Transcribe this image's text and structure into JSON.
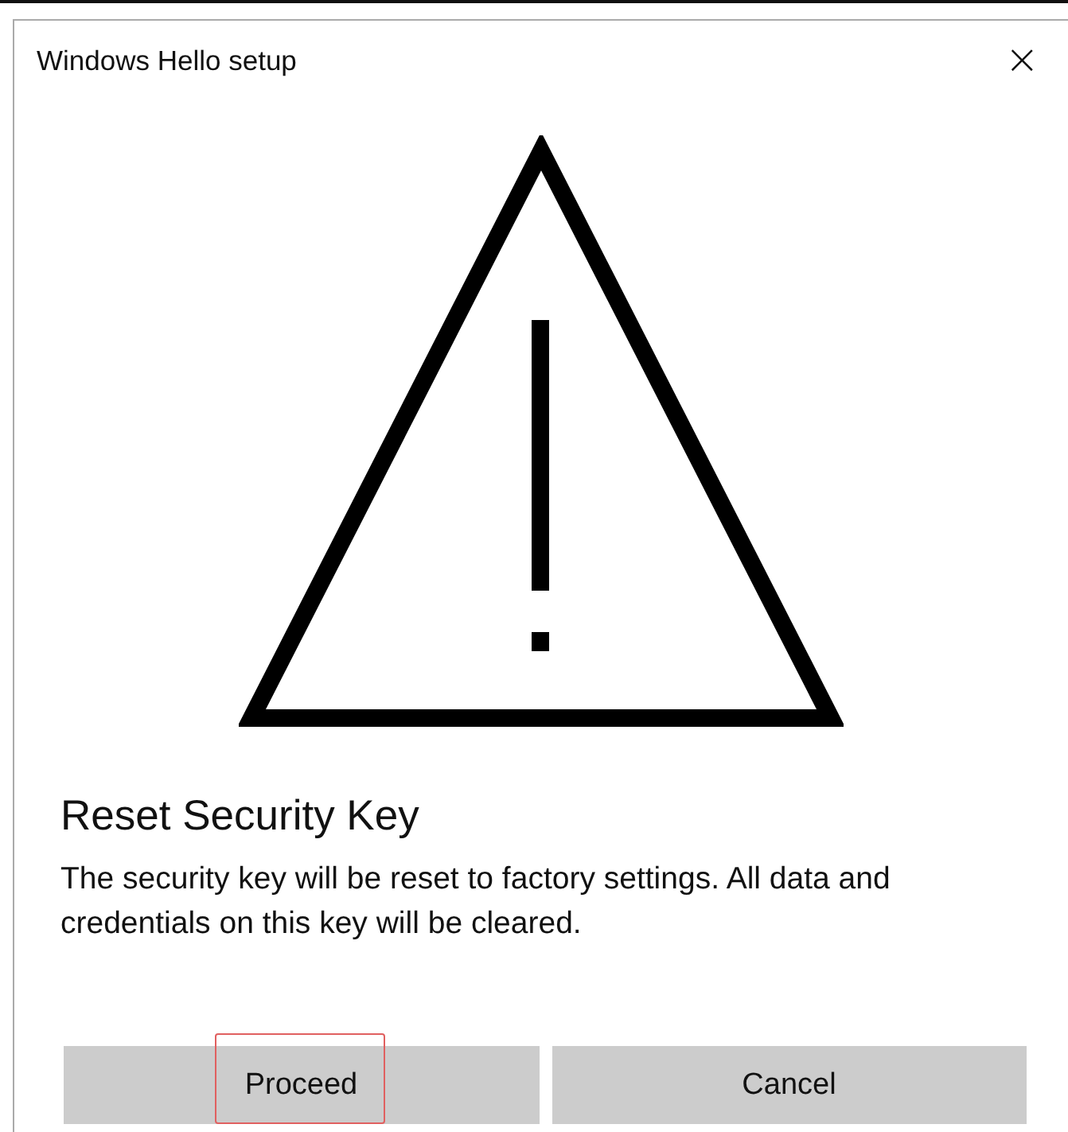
{
  "window": {
    "title": "Windows Hello setup",
    "close": "×"
  },
  "heading": "Reset Security Key",
  "message": "The security key will be reset to factory settings. All data and credentials on this key will be cleared.",
  "buttons": [
    {
      "label": "Proceed",
      "highlighted": true
    },
    {
      "label": "Cancel",
      "highlighted": false
    }
  ]
}
